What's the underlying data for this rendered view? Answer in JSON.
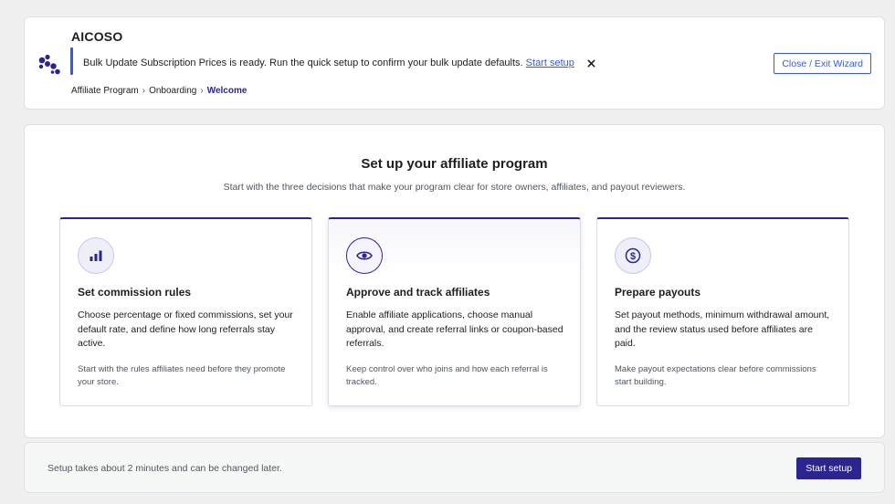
{
  "app": {
    "brand": "AICOSO",
    "exit_button": "Close / Exit Wizard"
  },
  "notice": {
    "message": "Bulk Update Subscription Prices is ready. Run the quick setup to confirm your bulk update defaults.",
    "link_label": "Start setup",
    "close_icon": "close-icon"
  },
  "breadcrumb": {
    "items": [
      "Affiliate Program",
      "Onboarding",
      "Welcome"
    ],
    "separator": "›"
  },
  "main": {
    "title": "Set up your affiliate program",
    "subtitle": "Start with the three decisions that make your program clear for store owners, affiliates, and payout reviewers.",
    "options": [
      {
        "icon": "bar-chart-icon",
        "title": "Set commission rules",
        "description": "Choose percentage or fixed commissions, set your default rate, and define how long referrals stay active.",
        "note": "Start with the rules affiliates need before they promote your store.",
        "selected": false
      },
      {
        "icon": "eye-icon",
        "title": "Approve and track affiliates",
        "description": "Enable affiliate applications, choose manual approval, and create referral links or coupon-based referrals.",
        "note": "Keep control over who joins and how each referral is tracked.",
        "selected": true
      },
      {
        "icon": "dollar-icon",
        "title": "Prepare payouts",
        "description": "Set payout methods, minimum withdrawal amount, and the review status used before affiliates are paid.",
        "note": "Make payout expectations clear before commissions start building.",
        "selected": false
      }
    ]
  },
  "footer": {
    "text": "Setup takes about 2 minutes and can be changed later.",
    "button": "Start setup"
  },
  "colors": {
    "primary": "#2c2590",
    "link": "#3858e9",
    "background": "#f0f0f1"
  }
}
